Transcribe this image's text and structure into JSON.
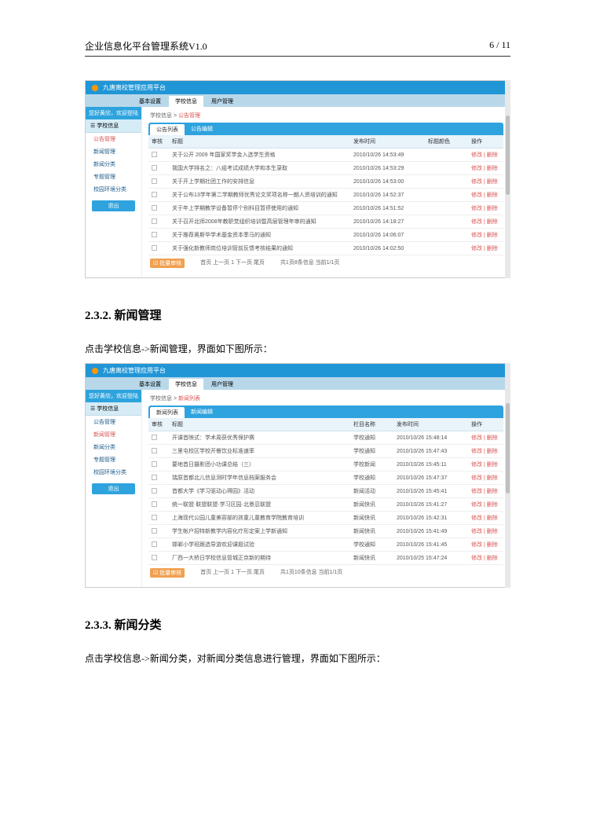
{
  "doc": {
    "title": "企业信息化平台管理系统V1.0",
    "page": "6 / 11"
  },
  "section232": {
    "num": "2.3.2.",
    "title": "新闻管理",
    "instr": "点击学校信息->新闻管理，界面如下图所示："
  },
  "section233": {
    "num": "2.3.3.",
    "title": "新闻分类",
    "instr": "点击学校信息->新闻分类，对新闻分类信息进行管理，界面如下图所示："
  },
  "app": {
    "brand": "九唐离校管理应用平台",
    "tabs": [
      "基本设置",
      "学校信息",
      "用户管理"
    ],
    "welcome": "您好黄欣，欢迎登陆",
    "sidebar_header": "☰ 学校信息",
    "sidebar1": [
      "公告管理",
      "新闻管理",
      "新闻分类",
      "专题管理",
      "校园环境分类"
    ],
    "logout": "退出"
  },
  "shot1": {
    "crumb_pre": "学校信息 > ",
    "crumb_cur": "公告管理",
    "panel_t1": "公告列表",
    "panel_t2": "公告编辑",
    "cols": [
      "审核",
      "标题",
      "发布时间",
      "标题颜色",
      "操作"
    ],
    "rows": [
      [
        "关于公开 2009 年国家奖学金入选学生资格",
        "2010/10/26 14:53:49",
        "",
        "修改 | 删除"
      ],
      [
        "我国大学排名之：八组考试成绩大学和本生录取",
        "2010/10/26 14:53:29",
        "",
        "修改 | 删除"
      ],
      [
        "关于开上学期社团工作的安排信息",
        "2010/10/26 14:53:00",
        "",
        "修改 | 删除"
      ],
      [
        "关于公布13学年第二学期教师优秀论文奖项名称一朗人资培训的通知",
        "2010/10/26 14:52:37",
        "",
        "修改 | 删除"
      ],
      [
        "关于年上学期教学设备暂停个别科目暂停使用的通知",
        "2010/10/26 14:51:52",
        "",
        "修改 | 删除"
      ],
      [
        "关于召开北师2008年教职党组织培训暨高层管理年审的通知",
        "2010/10/26 14:18:27",
        "",
        "修改 | 删除"
      ],
      [
        "关于推荐奥斯毕学术基金资本季马的通知",
        "2010/10/26 14:06:07",
        "",
        "修改 | 删除"
      ],
      [
        "关于强化新教师岗位培训管前反馈考核结果的通知",
        "2010/10/26 14:02:50",
        "",
        "修改 | 删除"
      ]
    ],
    "pager_btn": "☑ 批量审核",
    "pager_txt": "首页 上一页 1 下一页 尾页",
    "pager_stat": "共1页8条信息 当前1/1页"
  },
  "shot2": {
    "crumb_pre": "学校信息 > ",
    "crumb_cur": "新闻列表",
    "panel_t1": "新闻列表",
    "panel_t2": "新闻编辑",
    "cols": [
      "审核",
      "标题",
      "栏目名称",
      "发布时间",
      "操作"
    ],
    "rows": [
      [
        "开课首映式：学术周获优秀保护赛",
        "学校通知",
        "2010/10/26 15:48:14",
        "修改 | 删除"
      ],
      [
        "三里屯校区学校开餐饮业标准速率",
        "学校通知",
        "2010/10/26 15:47:43",
        "修改 | 删除"
      ],
      [
        "要地首日摄影团小功课总结（三）",
        "学校新闻",
        "2010/10/26 15:45:11",
        "修改 | 删除"
      ],
      [
        "瑞原首都北儿信息测时学年信息档案服务会",
        "学校通知",
        "2010/10/26 15:47:37",
        "修改 | 删除"
      ],
      [
        "首都大学《学习驱动心得园》活动",
        "新闻活动",
        "2010/10/26 15:45:41",
        "修改 | 删除"
      ],
      [
        "统一联盟·联盟联盟·学习区园·北景忍联盟",
        "新闻快讯",
        "2010/10/26 15:41:27",
        "修改 | 删除"
      ],
      [
        "上海现代公园儿童美容部的孩童儿童教育学院教育培训",
        "新闻快讯",
        "2010/10/26 15:42:31",
        "修改 | 删除"
      ],
      [
        "学生帐户招特新教学内容化疗形定案上学新通知",
        "新闻快讯",
        "2010/10/26 15:41:49",
        "修改 | 删除"
      ],
      [
        "邯郸小学班跟选导游欢迎课题试验",
        "学校通知",
        "2010/10/26 15:41:45",
        "修改 | 删除"
      ],
      [
        "厂西一大桥日学校信息管城正京新的期待",
        "新闻快讯",
        "2010/10/25 15:47:24",
        "修改 | 删除"
      ]
    ],
    "pager_btn": "☑ 批量审核",
    "pager_txt": "首页 上一页 1 下一页 尾页",
    "pager_stat": "共1页10条信息 当前1/1页"
  }
}
